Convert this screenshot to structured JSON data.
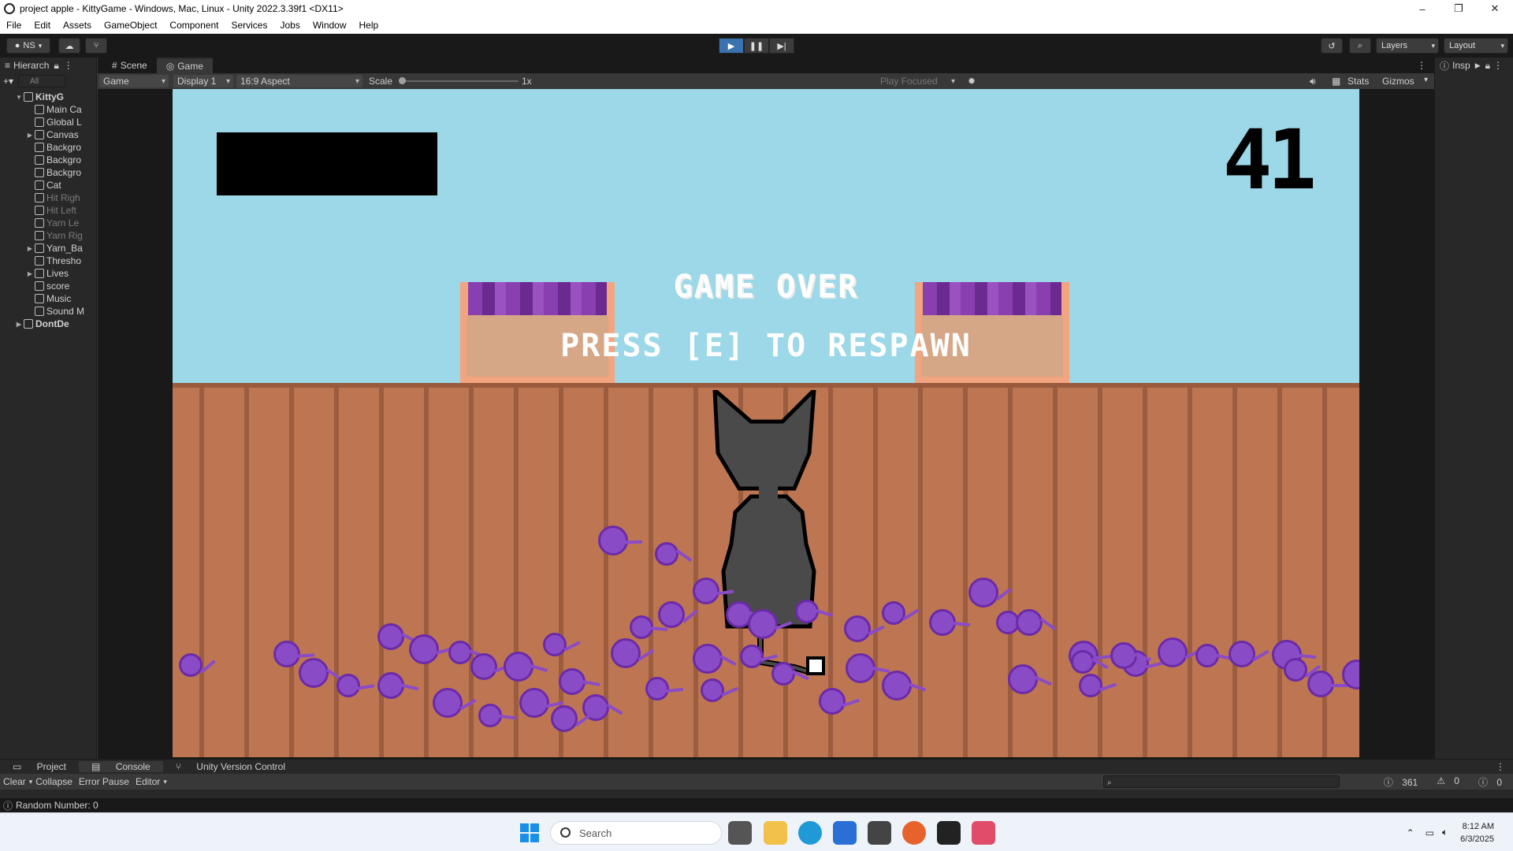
{
  "window": {
    "title": "project apple - KittyGame - Windows, Mac, Linux - Unity 2022.3.39f1 <DX11>",
    "controls": [
      "–",
      "❐",
      "✕"
    ]
  },
  "menu": [
    "File",
    "Edit",
    "Assets",
    "GameObject",
    "Component",
    "Services",
    "Jobs",
    "Window",
    "Help"
  ],
  "toolbar": {
    "account": "NS",
    "layers": "Layers",
    "layout": "Layout"
  },
  "hierarchy": {
    "tab": "Hierarch",
    "search_placeholder": "All",
    "items": [
      {
        "label": "KittyG",
        "expand": "▼",
        "dim": false,
        "bold": true
      },
      {
        "label": "Main Ca",
        "expand": "",
        "dim": false
      },
      {
        "label": "Global L",
        "expand": "",
        "dim": false
      },
      {
        "label": "Canvas",
        "expand": "▶",
        "dim": false
      },
      {
        "label": "Backgro",
        "expand": "",
        "dim": false
      },
      {
        "label": "Backgro",
        "expand": "",
        "dim": false
      },
      {
        "label": "Backgro",
        "expand": "",
        "dim": false
      },
      {
        "label": "Cat",
        "expand": "",
        "dim": false
      },
      {
        "label": "Hit Righ",
        "expand": "",
        "dim": true
      },
      {
        "label": "Hit Left",
        "expand": "",
        "dim": true
      },
      {
        "label": "Yarn Le",
        "expand": "",
        "dim": true
      },
      {
        "label": "Yarn Rig",
        "expand": "",
        "dim": true
      },
      {
        "label": "Yarn_Ba",
        "expand": "▶",
        "dim": false
      },
      {
        "label": "Thresho",
        "expand": "",
        "dim": false
      },
      {
        "label": "Lives",
        "expand": "▶",
        "dim": false
      },
      {
        "label": "score",
        "expand": "",
        "dim": false
      },
      {
        "label": "Music",
        "expand": "",
        "dim": false
      },
      {
        "label": "Sound M",
        "expand": "",
        "dim": false
      },
      {
        "label": "DontDe",
        "expand": "▶",
        "dim": false,
        "bold": true
      }
    ]
  },
  "game_view": {
    "tabs": [
      "Scene",
      "Game"
    ],
    "mode": "Game",
    "display": "Display 1",
    "aspect": "16:9 Aspect",
    "scale_label": "Scale",
    "scale_value": "1x",
    "play_focused": "Play Focused",
    "stats": "Stats",
    "gizmos": "Gizmos"
  },
  "game": {
    "score": "41",
    "game_over": "GAME OVER",
    "respawn": "PRESS [E] TO RESPAWN"
  },
  "inspector": {
    "tab": "Insp"
  },
  "console": {
    "tabs": [
      "Project",
      "Console",
      "Unity Version Control"
    ],
    "tools": [
      "Clear",
      "Collapse",
      "Error Pause",
      "Editor"
    ],
    "count_info": "361",
    "count_warn": "0",
    "count_error": "0",
    "status": "Random Number: 0"
  },
  "taskbar": {
    "search": "Search",
    "time": "8:12 AM",
    "date": "6/3/2025"
  }
}
